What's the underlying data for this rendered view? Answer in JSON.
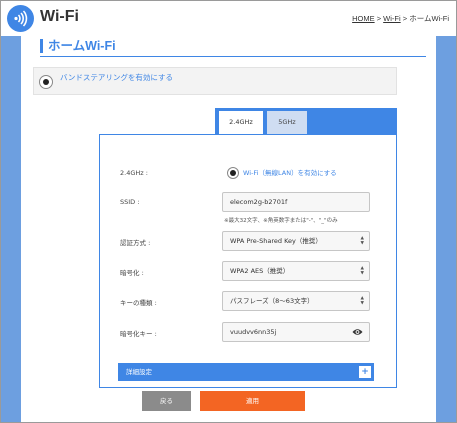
{
  "header": {
    "app_title": "Wi-Fi",
    "breadcrumb": {
      "home": "HOME",
      "sep1": " > ",
      "wifi": "Wi-Fi",
      "sep2": " > ",
      "current": "ホームWi-Fi"
    }
  },
  "page": {
    "title": "ホームWi-Fi",
    "band_steering_label": "バンドステアリングを有効にする"
  },
  "tabs": [
    {
      "label": "2.4GHz",
      "active": true
    },
    {
      "label": "5GHz",
      "active": false
    }
  ],
  "form": {
    "band_label": "2.4GHz :",
    "wifi_enable_label": "Wi-Fi（無線LAN）を有効にする",
    "ssid_label": "SSID :",
    "ssid_value": "elecom2g-b2701f",
    "ssid_hint": "※最大32文字、※角英数字または\"-\"、\"_\"のみ",
    "auth_label": "認証方式 :",
    "auth_value": "WPA Pre-Shared Key（推奨）",
    "encryption_label": "暗号化 :",
    "encryption_value": "WPA2 AES（推奨）",
    "key_type_label": "キーの種類 :",
    "key_type_value": "パスフレーズ（8〜63文字）",
    "key_label": "暗号化キー :",
    "key_value": "vuudvv6nn35j",
    "advanced_label": "詳細設定"
  },
  "buttons": {
    "back": "戻る",
    "apply": "適用"
  },
  "colors": {
    "accent": "#3f86e5",
    "background": "#6d9fe0",
    "apply": "#f36523",
    "back": "#8b8b8b"
  },
  "icons": {
    "logo": "wifi-icon",
    "show_password": "eye-icon",
    "expand": "plus-icon",
    "select": "chevron-up-down-icon"
  }
}
